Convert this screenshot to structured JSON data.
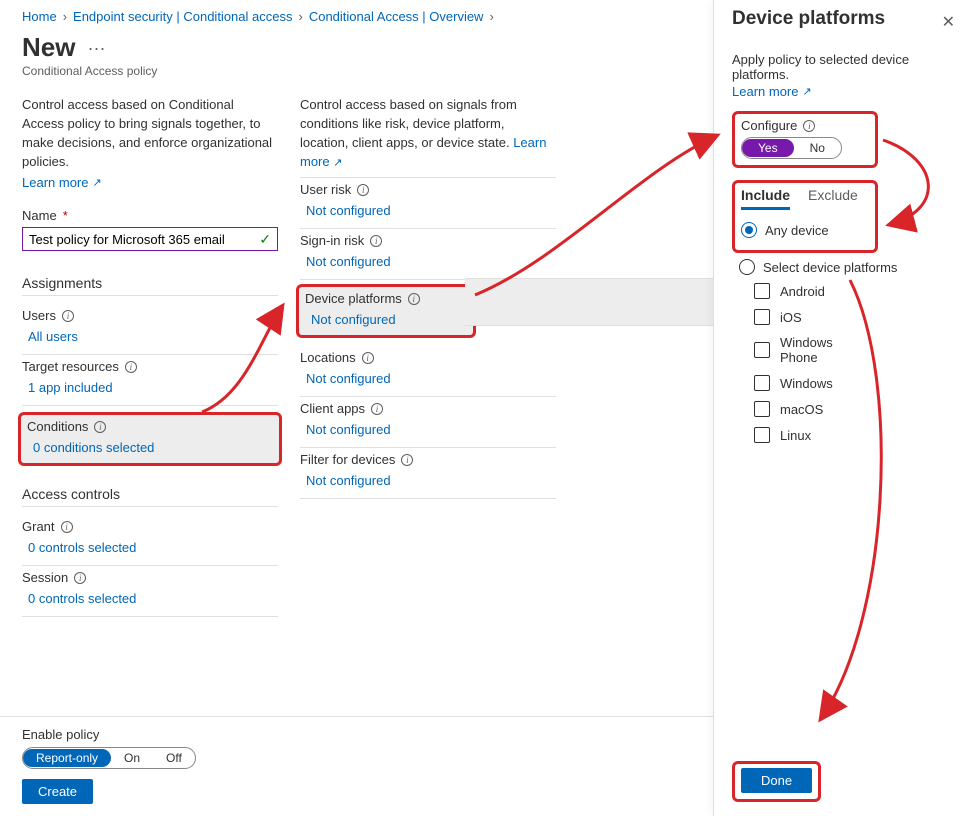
{
  "breadcrumb": {
    "home": "Home",
    "ep": "Endpoint security | Conditional access",
    "ca": "Conditional Access | Overview"
  },
  "page": {
    "title": "New",
    "subtitle": "Conditional Access policy"
  },
  "col1": {
    "intro": "Control access based on Conditional Access policy to bring signals together, to make decisions, and enforce organizational policies.",
    "learn": "Learn more",
    "name_label": "Name",
    "name_value": "Test policy for Microsoft 365 email",
    "assignments_h": "Assignments",
    "users_label": "Users",
    "users_val": "All users",
    "target_label": "Target resources",
    "target_val": "1 app included",
    "conditions_label": "Conditions",
    "conditions_val": "0 conditions selected",
    "access_h": "Access controls",
    "grant_label": "Grant",
    "grant_val": "0 controls selected",
    "session_label": "Session",
    "session_val": "0 controls selected"
  },
  "col2": {
    "intro": "Control access based on signals from conditions like risk, device platform, location, client apps, or device state.",
    "learn": "Learn more",
    "items": [
      {
        "label": "User risk",
        "val": "Not configured"
      },
      {
        "label": "Sign-in risk",
        "val": "Not configured"
      },
      {
        "label": "Device platforms",
        "val": "Not configured"
      },
      {
        "label": "Locations",
        "val": "Not configured"
      },
      {
        "label": "Client apps",
        "val": "Not configured"
      },
      {
        "label": "Filter for devices",
        "val": "Not configured"
      }
    ]
  },
  "footer": {
    "label": "Enable policy",
    "opt1": "Report-only",
    "opt2": "On",
    "opt3": "Off",
    "create": "Create"
  },
  "panel": {
    "title": "Device platforms",
    "desc": "Apply policy to selected device platforms.",
    "learn": "Learn more",
    "configure": "Configure",
    "yes": "Yes",
    "no": "No",
    "tab_include": "Include",
    "tab_exclude": "Exclude",
    "any_device": "Any device",
    "select_platforms": "Select device platforms",
    "platforms": [
      "Android",
      "iOS",
      "Windows Phone",
      "Windows",
      "macOS",
      "Linux"
    ],
    "done": "Done"
  }
}
